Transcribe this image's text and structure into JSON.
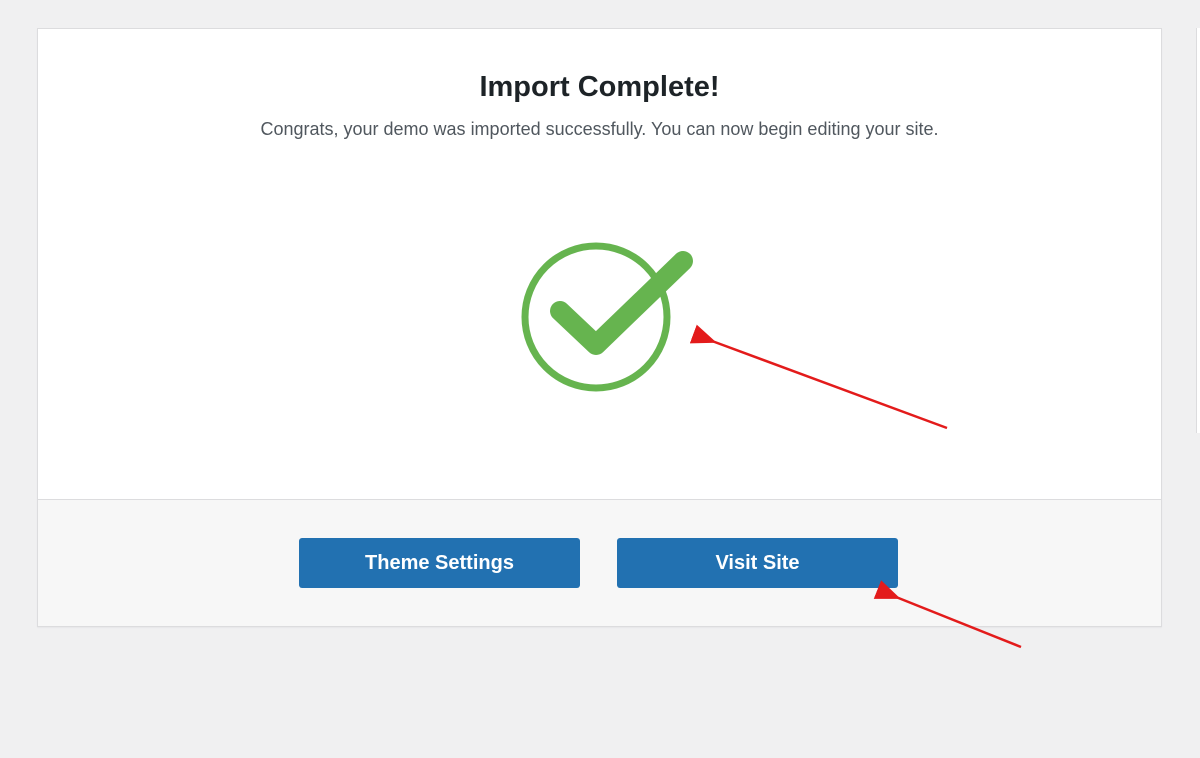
{
  "import": {
    "title": "Import Complete!",
    "message": "Congrats, your demo was imported successfully. You can now begin editing your site."
  },
  "status_icon": {
    "name": "check-circle-icon",
    "color": "#66b44f"
  },
  "buttons": {
    "theme_settings": "Theme Settings",
    "visit_site": "Visit Site"
  },
  "colors": {
    "button_bg": "#2271b1",
    "annotation_arrow": "#e31b1b",
    "page_bg": "#f0f0f1",
    "footer_bg": "#f7f7f7"
  }
}
